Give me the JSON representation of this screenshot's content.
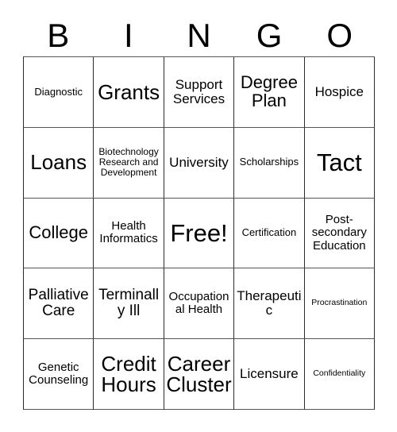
{
  "card": {
    "title": "BINGO",
    "header_letters": [
      "B",
      "I",
      "N",
      "G",
      "O"
    ],
    "columns": 5,
    "rows": 5,
    "free_space": "Free!",
    "colors": {
      "background": "#ffffff",
      "text": "#000000",
      "grid_line": "#2b2b2b"
    },
    "cells": [
      {
        "text": "Diagnostic",
        "size": "sm"
      },
      {
        "text": "Grants",
        "size": "xxl"
      },
      {
        "text": "Support Services",
        "size": "ml"
      },
      {
        "text": "Degree Plan",
        "size": "xl"
      },
      {
        "text": "Hospice",
        "size": "ml"
      },
      {
        "text": "Loans",
        "size": "xxl"
      },
      {
        "text": "Biotechnology Research and Development",
        "size": "s"
      },
      {
        "text": "University",
        "size": "ml"
      },
      {
        "text": "Scholarships",
        "size": "sm"
      },
      {
        "text": "Tact",
        "size": "huge"
      },
      {
        "text": "College",
        "size": "xl"
      },
      {
        "text": "Health Informatics",
        "size": "m"
      },
      {
        "text": "Free!",
        "size": "huge"
      },
      {
        "text": "Certification",
        "size": "sm"
      },
      {
        "text": "Post-secondary Education",
        "size": "m"
      },
      {
        "text": "Palliative Care",
        "size": "l"
      },
      {
        "text": "Terminally Ill",
        "size": "l"
      },
      {
        "text": "Occupational Health",
        "size": "m"
      },
      {
        "text": "Therapeutic",
        "size": "ml"
      },
      {
        "text": "Procrastination",
        "size": "xs"
      },
      {
        "text": "Genetic Counseling",
        "size": "m"
      },
      {
        "text": "Credit Hours",
        "size": "xxl"
      },
      {
        "text": "Career Cluster",
        "size": "xxl"
      },
      {
        "text": "Licensure",
        "size": "ml"
      },
      {
        "text": "Confidentiality",
        "size": "xs"
      }
    ]
  }
}
